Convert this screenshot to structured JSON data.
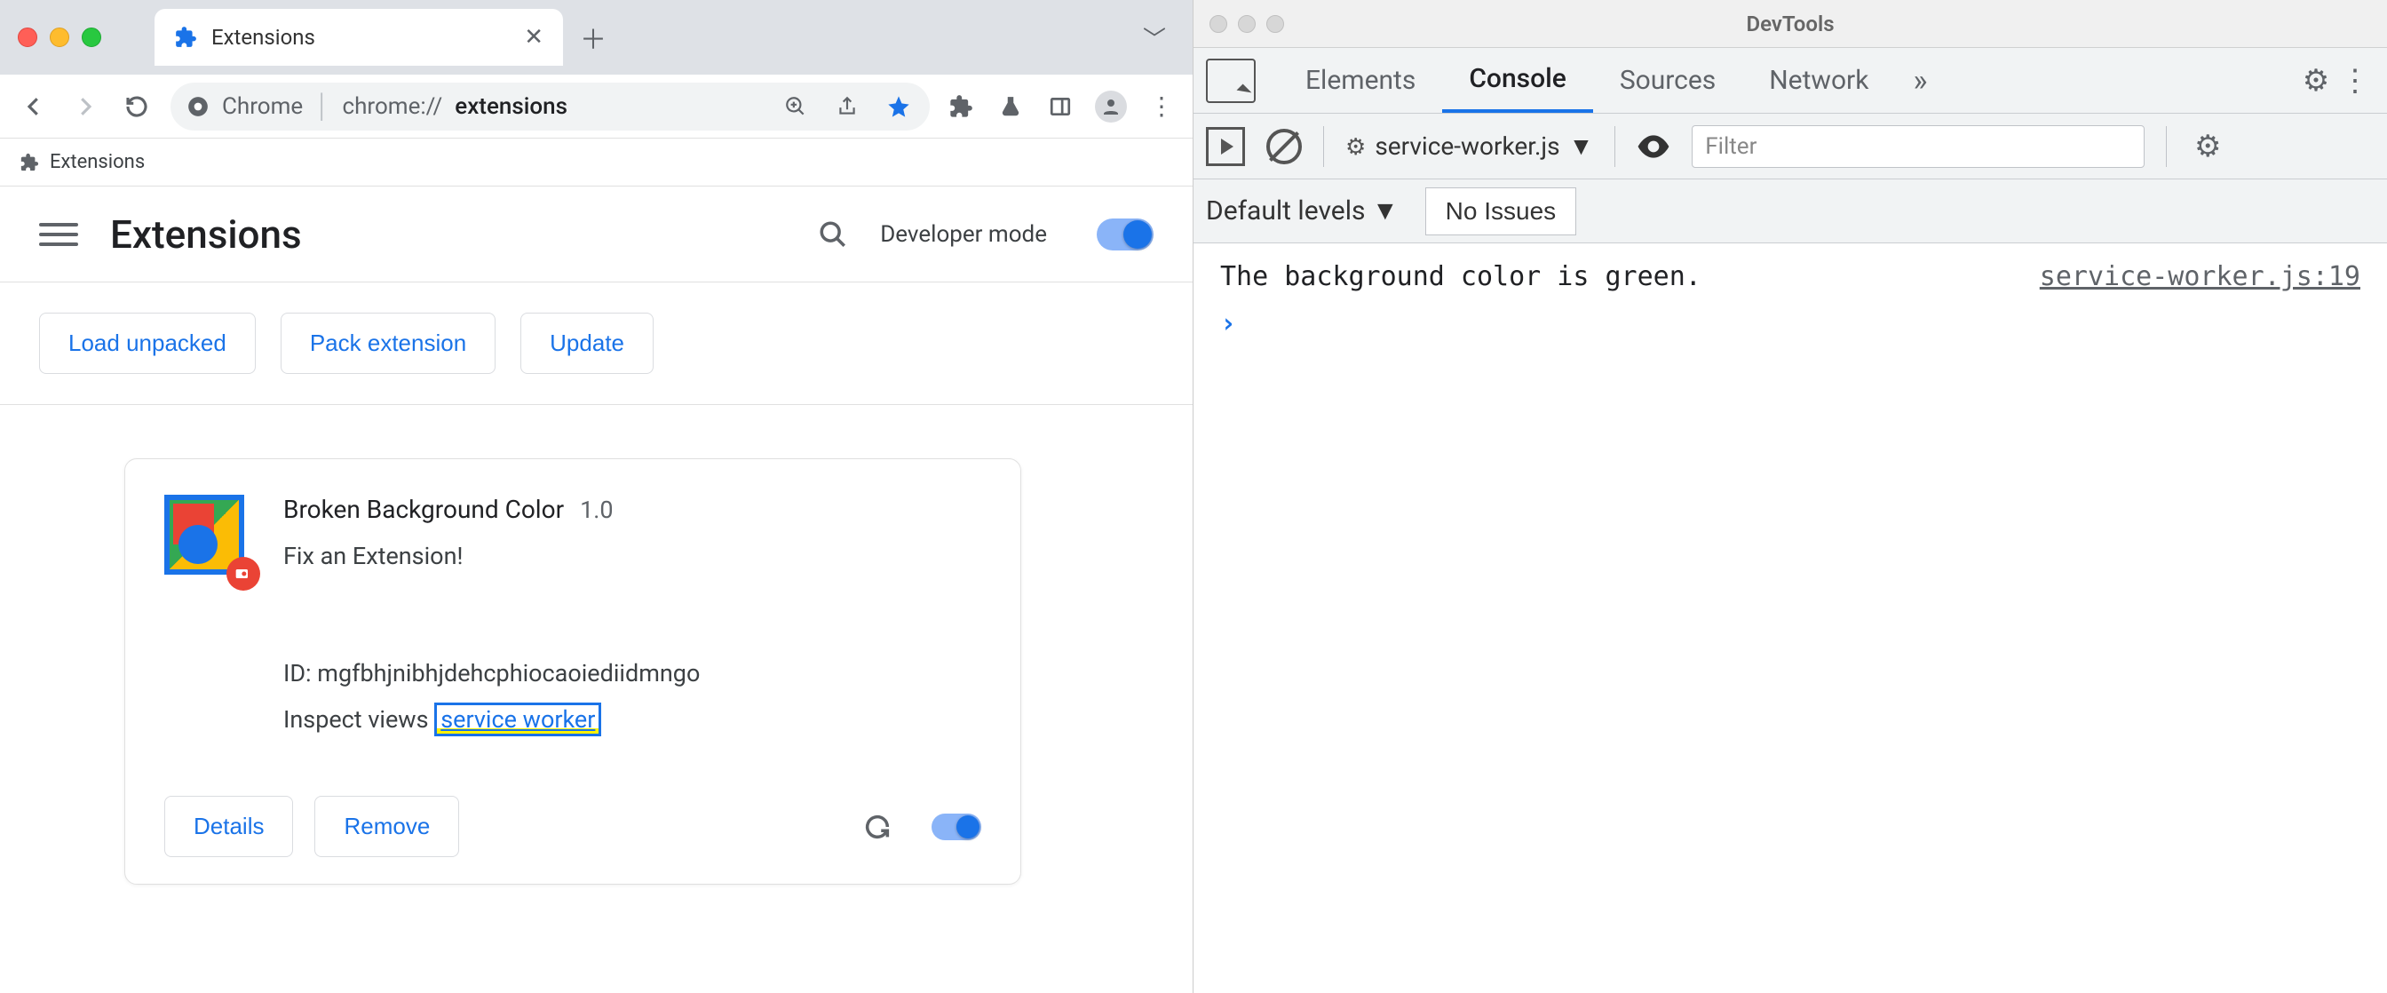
{
  "chrome": {
    "tab": {
      "title": "Extensions"
    },
    "omnibox": {
      "prefix": "Chrome",
      "url_plain": "chrome://",
      "url_bold": "extensions"
    },
    "bookmark_bar": {
      "item1": "Extensions"
    },
    "extensions_page": {
      "title": "Extensions",
      "dev_mode_label": "Developer mode",
      "buttons": {
        "load_unpacked": "Load unpacked",
        "pack_extension": "Pack extension",
        "update": "Update"
      },
      "card": {
        "name": "Broken Background Color",
        "version": "1.0",
        "description": "Fix an Extension!",
        "id_label": "ID: mgfbhjnibhjdehcphiocaoiediidmngo",
        "inspect_label": "Inspect views ",
        "inspect_link": "service worker",
        "details": "Details",
        "remove": "Remove"
      }
    }
  },
  "devtools": {
    "title": "DevTools",
    "tabs": {
      "elements": "Elements",
      "console": "Console",
      "sources": "Sources",
      "network": "Network"
    },
    "toolbar": {
      "context": "service-worker.js",
      "filter_placeholder": "Filter"
    },
    "toolbar2": {
      "levels": "Default levels",
      "issues": "No Issues"
    },
    "console": {
      "log_message": "The background color is green.",
      "log_source": "service-worker.js:19"
    }
  }
}
